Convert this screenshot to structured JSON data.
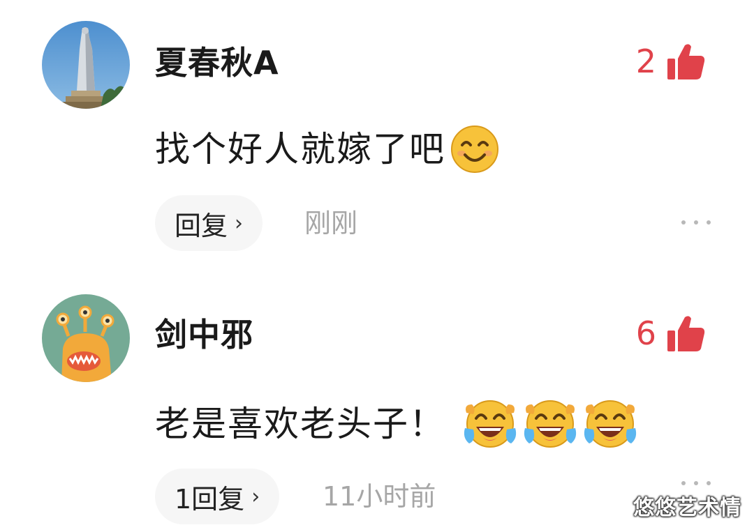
{
  "comments": [
    {
      "username": "夏春秋A",
      "likes": "2",
      "text": "找个好人就嫁了吧",
      "reply_label": "回复",
      "reply_chevron": "›",
      "time": "刚刚",
      "emojis": [
        "smiling-emoji"
      ],
      "avatar": "statue-avatar"
    },
    {
      "username": "剑中邪",
      "likes": "6",
      "text": "老是喜欢老头子！",
      "reply_label": "1回复",
      "reply_chevron": "›",
      "time": "11小时前",
      "emojis": [
        "laughing-crying-emoji",
        "laughing-crying-emoji",
        "laughing-crying-emoji"
      ],
      "avatar": "monster-avatar"
    }
  ],
  "colors": {
    "like": "#e0424a",
    "time": "#a6a6a6",
    "text": "#1a1a1a"
  },
  "watermark": "悠悠艺术情"
}
